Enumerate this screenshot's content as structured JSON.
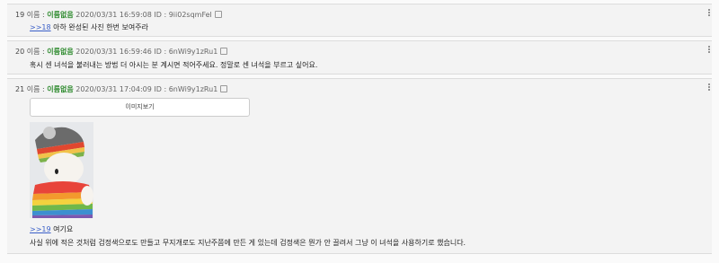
{
  "posts": [
    {
      "number": "19",
      "name_label": "이름 :",
      "author": "이름없음",
      "datetime": "2020/03/31 16:59:08",
      "id_label": "ID :",
      "user_id": "9ii02sqmFel",
      "reply_link": ">>18",
      "text": "아하 완성된 사진 한번 보여주라"
    },
    {
      "number": "20",
      "name_label": "이름 :",
      "author": "이름없음",
      "datetime": "2020/03/31 16:59:46",
      "id_label": "ID :",
      "user_id": "6nWi9y1zRu1",
      "text": "혹시 센 녀석을 불러내는 방법 더 아시는 분 계시면 적어주세요. 정말로 센 녀석을 부르고 싶어요."
    },
    {
      "number": "21",
      "name_label": "이름 :",
      "author": "이름없음",
      "datetime": "2020/03/31 17:04:09",
      "id_label": "ID :",
      "user_id": "6nWi9y1zRu1",
      "image_button": "이미지보기",
      "reply_link": ">>19",
      "reply_text": "여기요",
      "text": "사실 위에 적은 것처럼 검정색으로도 만들고 무지개로도 지난주쯤에 만든 게 있는데 검정색은 뭔가 안 끌려서 그냥 이 녀석을 사용하기로 했습니다."
    }
  ],
  "icons": {
    "copy": "copy-icon",
    "menu": "more-vertical-icon"
  }
}
